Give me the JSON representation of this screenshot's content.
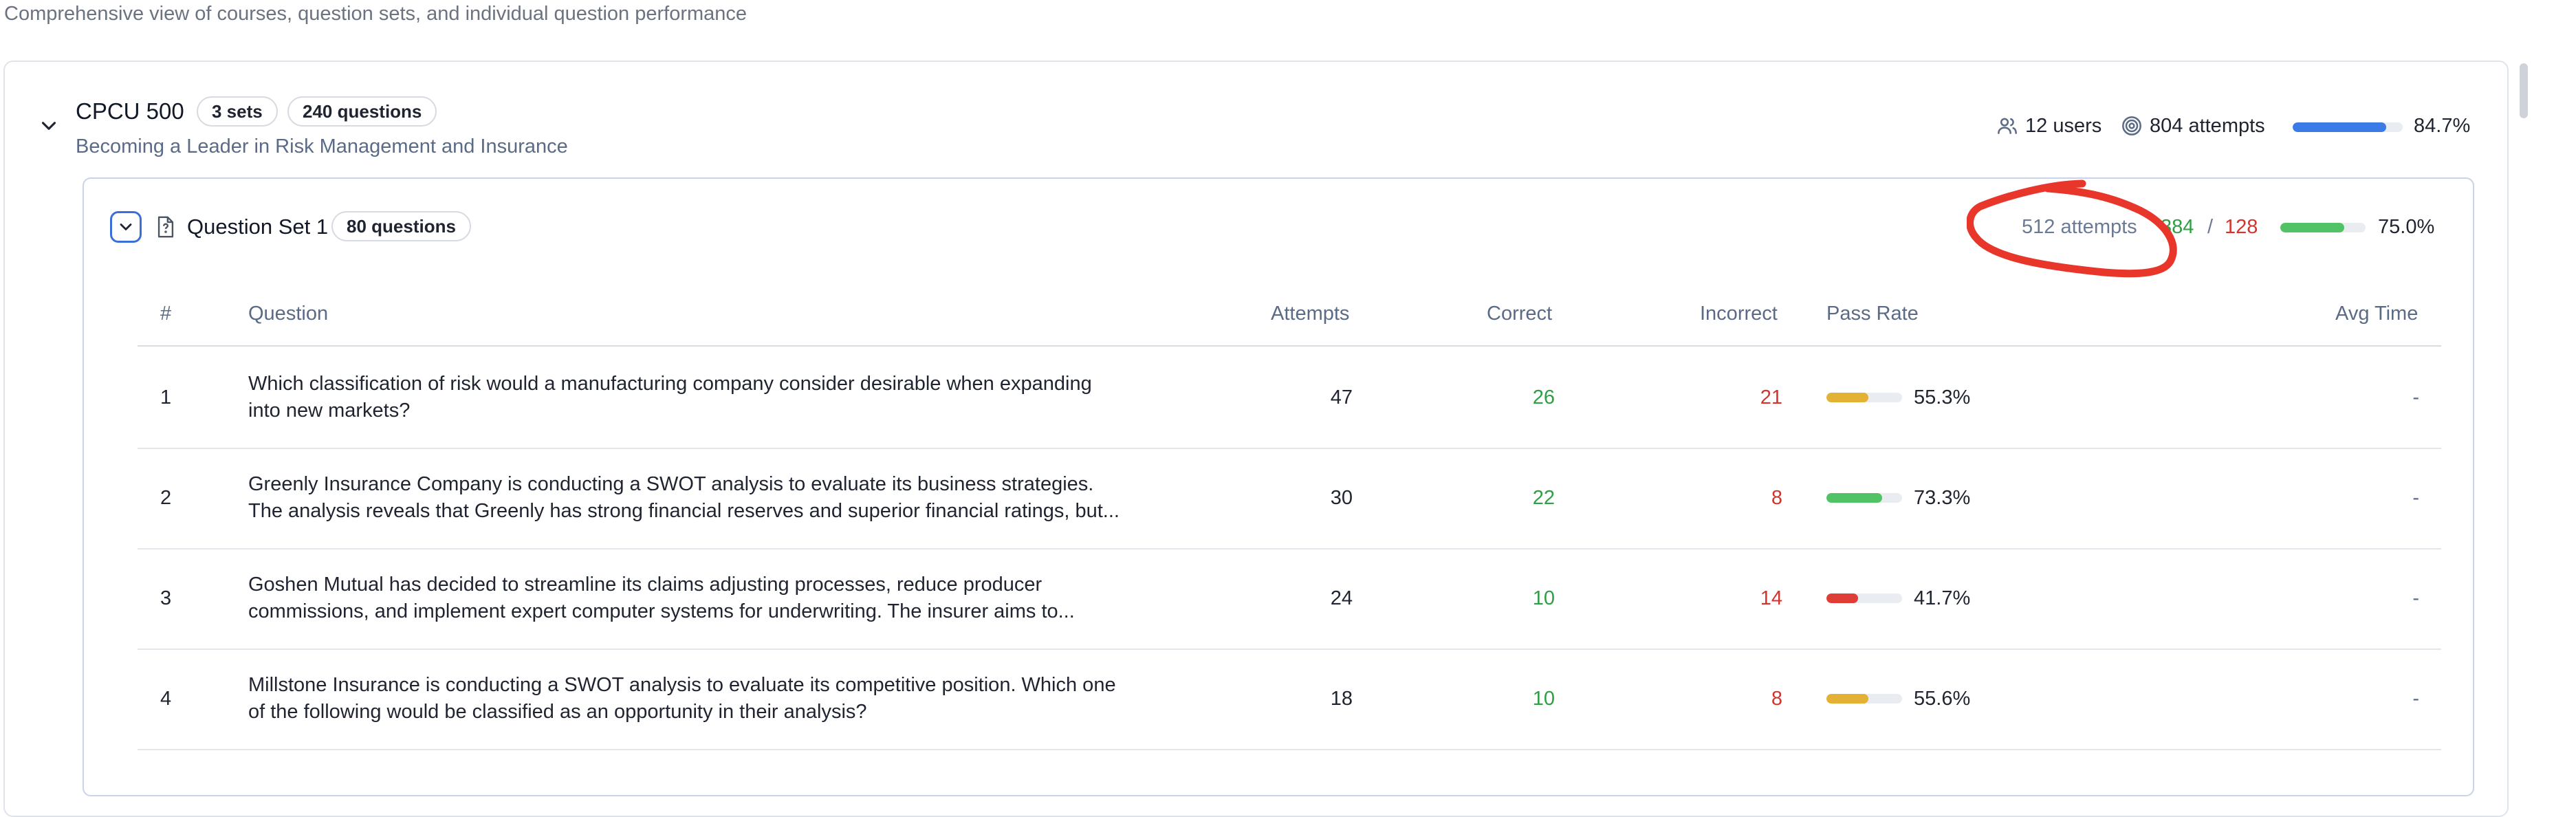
{
  "page": {
    "subtitle": "Comprehensive view of courses, question sets, and individual question performance"
  },
  "course": {
    "title": "CPCU 500",
    "sets_badge": "3 sets",
    "questions_badge": "240 questions",
    "description": "Becoming a Leader in Risk Management and Insurance",
    "users": "12 users",
    "attempts": "804 attempts",
    "pass_rate": "84.7%",
    "pass_rate_value": 84.7,
    "pass_rate_color": "#3b7be8"
  },
  "question_set": {
    "title": "Question Set 1",
    "questions_badge": "80 questions",
    "attempts": "512 attempts",
    "correct": "384",
    "separator": "/",
    "incorrect": "128",
    "pass_rate": "75.0%",
    "pass_rate_value": 75.0,
    "pass_rate_color": "#52c266"
  },
  "table": {
    "headers": {
      "index": "#",
      "question": "Question",
      "attempts": "Attempts",
      "correct": "Correct",
      "incorrect": "Incorrect",
      "pass_rate": "Pass Rate",
      "avg_time": "Avg Time"
    },
    "rows": [
      {
        "index": "1",
        "line1": "Which classification of risk would a manufacturing company consider desirable when expanding",
        "line2": "into new markets?",
        "attempts": "47",
        "correct": "26",
        "incorrect": "21",
        "pass_rate": "55.3%",
        "pass_rate_value": 55.3,
        "bar_color": "#e3b234",
        "avg_time": "-"
      },
      {
        "index": "2",
        "line1": "Greenly Insurance Company is conducting a SWOT analysis to evaluate its business strategies.",
        "line2": "The analysis reveals that Greenly has strong financial reserves and superior financial ratings, but...",
        "attempts": "30",
        "correct": "22",
        "incorrect": "8",
        "pass_rate": "73.3%",
        "pass_rate_value": 73.3,
        "bar_color": "#52c266",
        "avg_time": "-"
      },
      {
        "index": "3",
        "line1": "Goshen Mutual has decided to streamline its claims adjusting processes, reduce producer",
        "line2": "commissions, and implement expert computer systems for underwriting. The insurer aims to...",
        "attempts": "24",
        "correct": "10",
        "incorrect": "14",
        "pass_rate": "41.7%",
        "pass_rate_value": 41.7,
        "bar_color": "#de3e36",
        "avg_time": "-"
      },
      {
        "index": "4",
        "line1": "Millstone Insurance is conducting a SWOT analysis to evaluate its competitive position. Which one",
        "line2": "of the following would be classified as an opportunity in their analysis?",
        "attempts": "18",
        "correct": "10",
        "incorrect": "8",
        "pass_rate": "55.6%",
        "pass_rate_value": 55.6,
        "bar_color": "#e3b234",
        "avg_time": "-"
      }
    ]
  },
  "icons": {
    "collapse_course": "chevron-down-icon",
    "collapse_set": "chevron-down-icon",
    "set": "document-icon",
    "users": "users-icon",
    "attempts": "target-icon"
  },
  "annotation_color": "#e8362a"
}
